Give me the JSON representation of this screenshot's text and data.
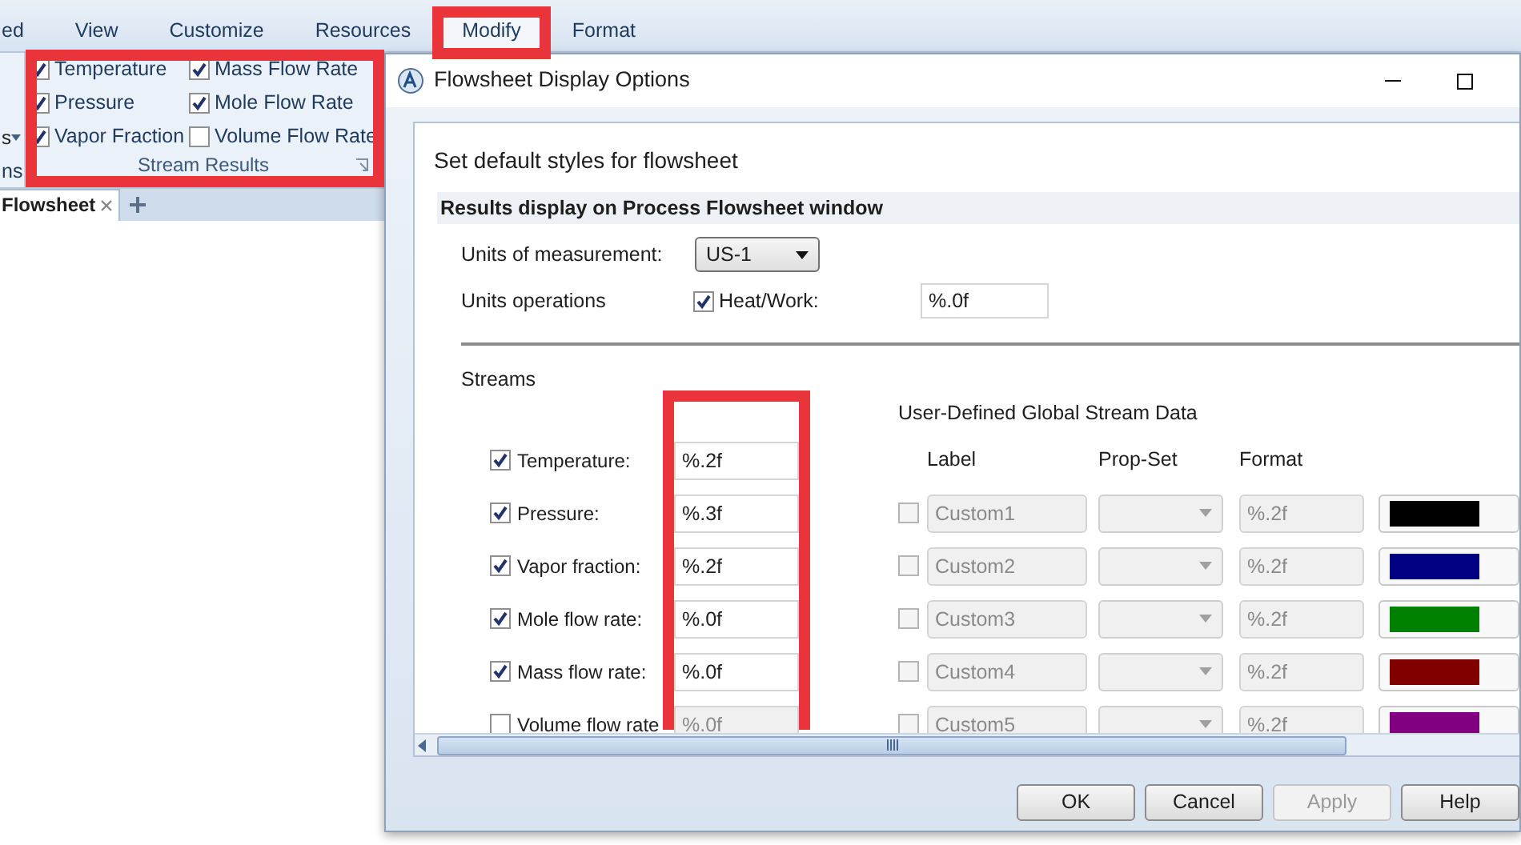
{
  "ribbon": {
    "tabs": [
      {
        "label": "ed",
        "selected": false,
        "highlighted": false
      },
      {
        "label": "View",
        "selected": false,
        "highlighted": false
      },
      {
        "label": "Customize",
        "selected": false,
        "highlighted": false
      },
      {
        "label": "Resources",
        "selected": false,
        "highlighted": false
      },
      {
        "label": "Modify",
        "selected": true,
        "highlighted": true
      },
      {
        "label": "Format",
        "selected": false,
        "highlighted": false
      }
    ],
    "cut_group": {
      "button": "s",
      "label": "ns"
    },
    "stream_results": {
      "label": "Stream Results",
      "highlighted": true,
      "options": [
        {
          "label": "Temperature",
          "checked": true
        },
        {
          "label": "Pressure",
          "checked": true
        },
        {
          "label": "Vapor Fraction",
          "checked": true
        },
        {
          "label": "Mass Flow Rate",
          "checked": true
        },
        {
          "label": "Mole Flow Rate",
          "checked": true
        },
        {
          "label": "Volume Flow Rate",
          "checked": false
        }
      ]
    }
  },
  "document_tabs": [
    {
      "label": "Flowsheet",
      "selected": true
    }
  ],
  "dialog": {
    "title": "Flowsheet Display Options",
    "heading": "Set default styles for flowsheet",
    "section": "Results display on Process Flowsheet window",
    "units_of_measurement": {
      "label": "Units of measurement:",
      "value": "US-1"
    },
    "unit_operations": {
      "label": "Units operations",
      "heat_work": {
        "label": "Heat/Work:",
        "checked": true,
        "format": "%.0f"
      }
    },
    "streams": {
      "title": "Streams",
      "format_column_highlighted": true,
      "rows": [
        {
          "label": "Temperature:",
          "checked": true,
          "format": "%.2f"
        },
        {
          "label": "Pressure:",
          "checked": true,
          "format": "%.3f"
        },
        {
          "label": "Vapor fraction:",
          "checked": true,
          "format": "%.2f"
        },
        {
          "label": "Mole flow rate:",
          "checked": true,
          "format": "%.0f"
        },
        {
          "label": "Mass flow rate:",
          "checked": true,
          "format": "%.0f"
        },
        {
          "label": "Volume flow rate",
          "checked": false,
          "format": "%.0f"
        }
      ]
    },
    "user_defined": {
      "title": "User-Defined Global Stream Data",
      "columns": [
        "Label",
        "Prop-Set",
        "Format"
      ],
      "rows": [
        {
          "checked": false,
          "label": "Custom1",
          "format": "%.2f",
          "color": "#000000"
        },
        {
          "checked": false,
          "label": "Custom2",
          "format": "%.2f",
          "color": "#000080"
        },
        {
          "checked": false,
          "label": "Custom3",
          "format": "%.2f",
          "color": "#008000"
        },
        {
          "checked": false,
          "label": "Custom4",
          "format": "%.2f",
          "color": "#800000"
        },
        {
          "checked": false,
          "label": "Custom5",
          "format": "%.2f",
          "color": "#800080"
        }
      ]
    },
    "buttons": [
      {
        "label": "OK",
        "disabled": false
      },
      {
        "label": "Cancel",
        "disabled": false
      },
      {
        "label": "Apply",
        "disabled": true
      },
      {
        "label": "Help",
        "disabled": false
      }
    ]
  }
}
